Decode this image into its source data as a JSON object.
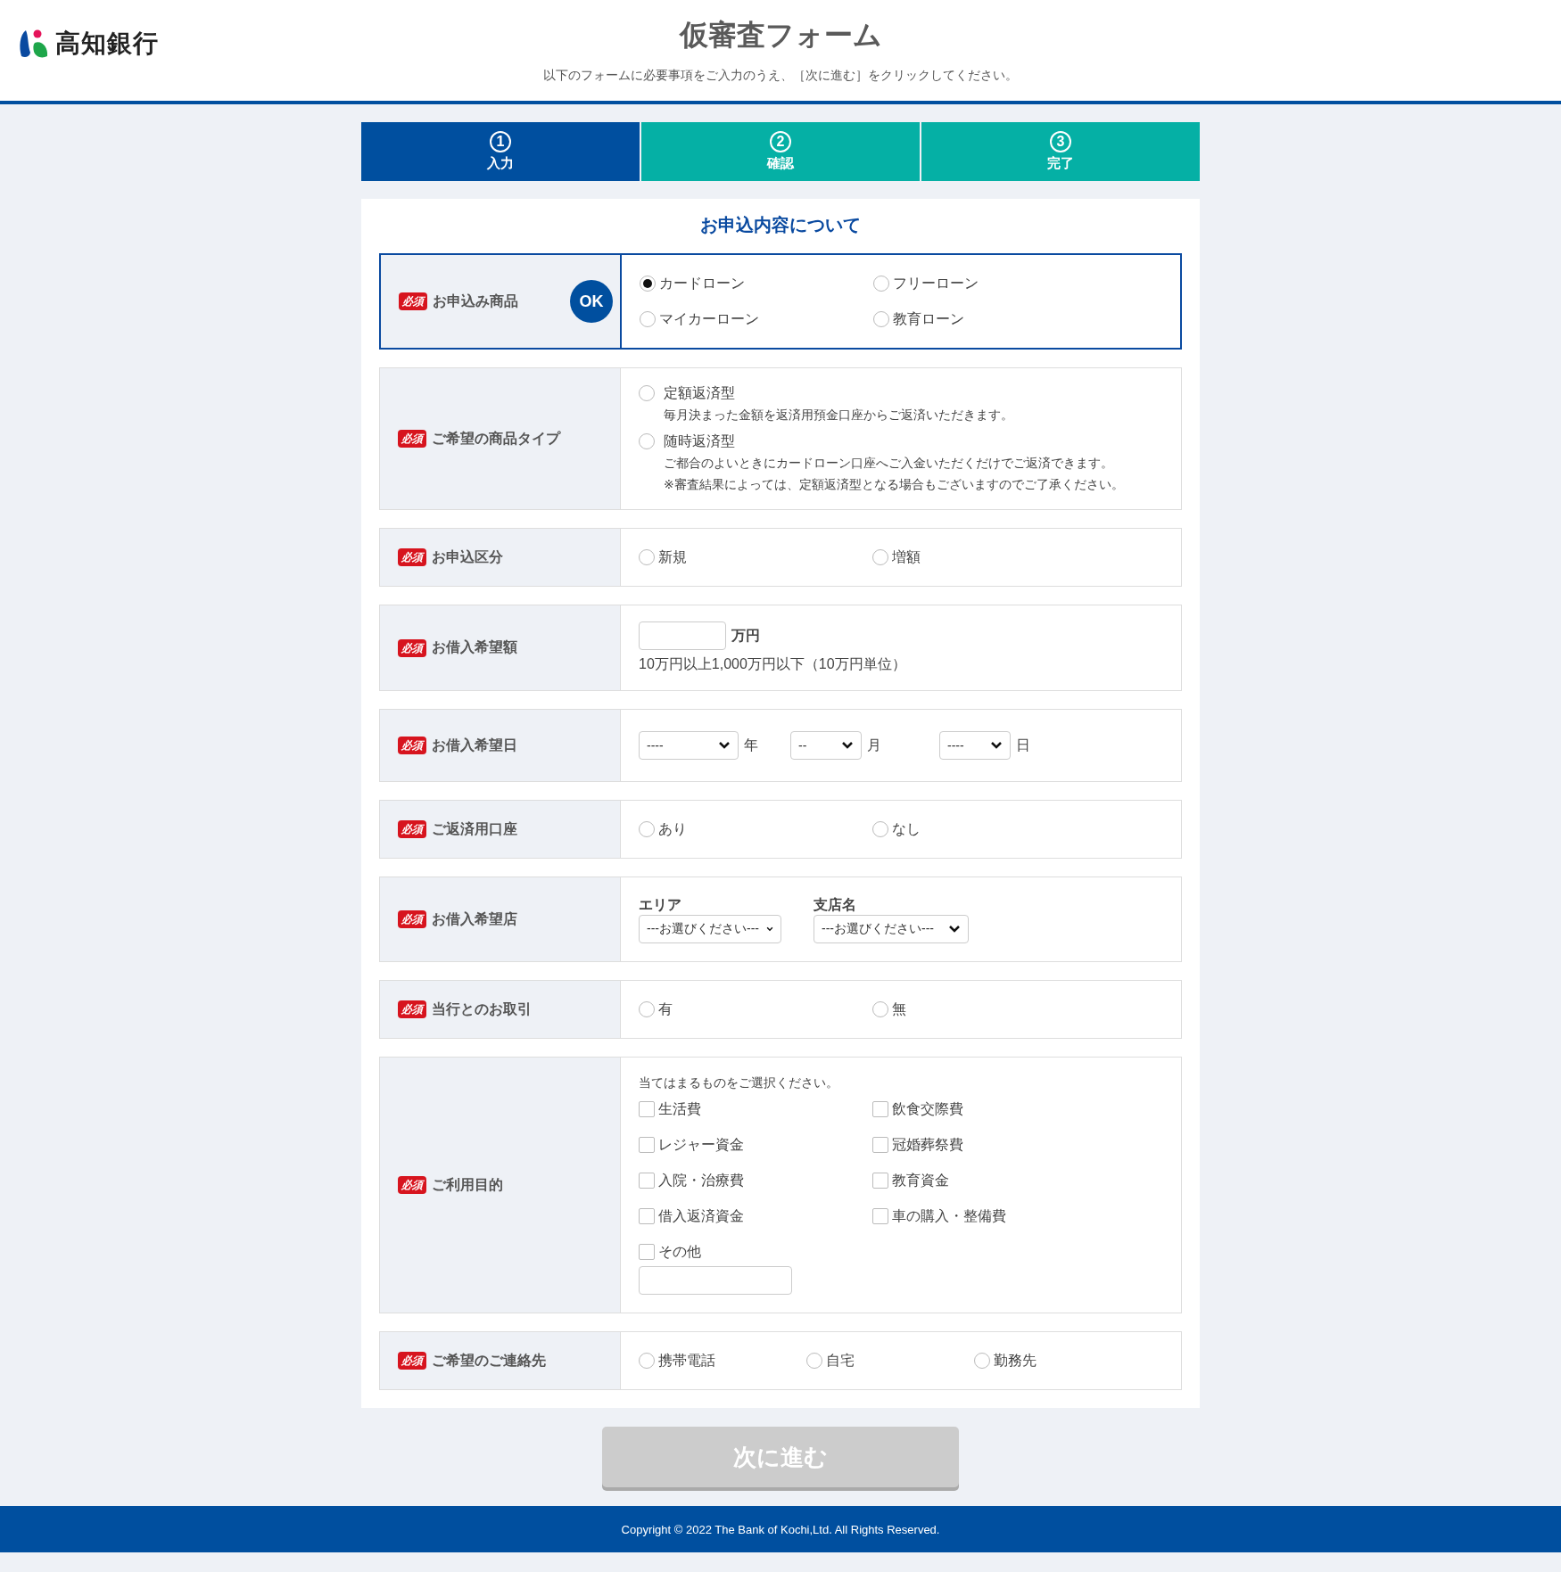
{
  "header": {
    "logo_text": "高知銀行",
    "title": "仮審査フォーム",
    "subtitle": "以下のフォームに必要事項をご入力のうえ、［次に進む］をクリックしてください。"
  },
  "steps": [
    {
      "number": "1",
      "label": "入力",
      "selected": true
    },
    {
      "number": "2",
      "label": "確認",
      "selected": false
    },
    {
      "number": "3",
      "label": "完了",
      "selected": false
    }
  ],
  "section_title": "お申込内容について",
  "rows": [
    {
      "kind": "radio",
      "badge": "必須",
      "label": "お申込み商品",
      "status": "OK",
      "active": true,
      "options": [
        {
          "label": "カードローン",
          "selected": true
        },
        {
          "label": "フリーローン",
          "selected": false
        },
        {
          "label": "マイカーローン",
          "selected": false
        },
        {
          "label": "教育ローン",
          "selected": false
        }
      ]
    },
    {
      "kind": "radio-desc",
      "badge": "必須",
      "label": "ご希望の商品タイプ",
      "active": false,
      "options": [
        {
          "label": "定額返済型",
          "selected": false,
          "descriptions": [
            "毎月決まった金額を返済用預金口座からご返済いただきます。"
          ]
        },
        {
          "label": "随時返済型",
          "selected": false,
          "descriptions": [
            "ご都合のよいときにカードローン口座へご入金いただくだけでご返済できます。",
            "※審査結果によっては、定額返済型となる場合もございますのでご了承ください。"
          ]
        }
      ]
    },
    {
      "kind": "radio",
      "badge": "必須",
      "label": "お申込区分",
      "active": false,
      "options": [
        {
          "label": "新規",
          "selected": false
        },
        {
          "label": "増額",
          "selected": false
        }
      ]
    },
    {
      "kind": "amount",
      "badge": "必須",
      "label": "お借入希望額",
      "active": false,
      "unit": "万円",
      "note": "10万円以上1,000万円以下（10万円単位）"
    },
    {
      "kind": "date",
      "badge": "必須",
      "label": "お借入希望日",
      "active": false,
      "selects": [
        {
          "value": "----",
          "unit": "年"
        },
        {
          "value": "--",
          "unit": "月"
        },
        {
          "value": "----",
          "unit": "日"
        }
      ]
    },
    {
      "kind": "radio",
      "badge": "必須",
      "label": "ご返済用口座",
      "active": false,
      "options": [
        {
          "label": "あり",
          "selected": false
        },
        {
          "label": "なし",
          "selected": false
        }
      ]
    },
    {
      "kind": "branch",
      "badge": "必須",
      "label": "お借入希望店",
      "active": false,
      "fields": [
        {
          "label": "エリア",
          "value": "---お選びください---"
        },
        {
          "label": "支店名",
          "value": "---お選びください---"
        }
      ]
    },
    {
      "kind": "radio",
      "badge": "必須",
      "label": "当行とのお取引",
      "active": false,
      "options": [
        {
          "label": "有",
          "selected": false
        },
        {
          "label": "無",
          "selected": false
        }
      ]
    },
    {
      "kind": "checkbox",
      "badge": "必須",
      "label": "ご利用目的",
      "active": false,
      "instruction": "当てはまるものをご選択ください。",
      "options": [
        {
          "kind": "check",
          "label": "生活費",
          "checked": false
        },
        {
          "kind": "check",
          "label": "飲食交際費",
          "checked": false
        },
        {
          "kind": "check",
          "label": "レジャー資金",
          "checked": false
        },
        {
          "kind": "check",
          "label": "冠婚葬祭費",
          "checked": false
        },
        {
          "kind": "check",
          "label": "入院・治療費",
          "checked": false
        },
        {
          "kind": "check",
          "label": "教育資金",
          "checked": false
        },
        {
          "kind": "check",
          "label": "借入返済資金",
          "checked": false
        },
        {
          "kind": "check",
          "label": "車の購入・整備費",
          "checked": false
        },
        {
          "kind": "check-text",
          "label": "その他",
          "checked": false
        }
      ]
    },
    {
      "kind": "radio",
      "badge": "必須",
      "label": "ご希望のご連絡先",
      "active": false,
      "options": [
        {
          "label": "携帯電話",
          "selected": false
        },
        {
          "label": "自宅",
          "selected": false
        },
        {
          "label": "勤務先",
          "selected": false
        }
      ]
    }
  ],
  "submit": {
    "label": "次に進む",
    "disabled": true
  },
  "footer": {
    "copyright": "Copyright © 2022 The Bank of Kochi,Ltd. All Rights Reserved."
  }
}
